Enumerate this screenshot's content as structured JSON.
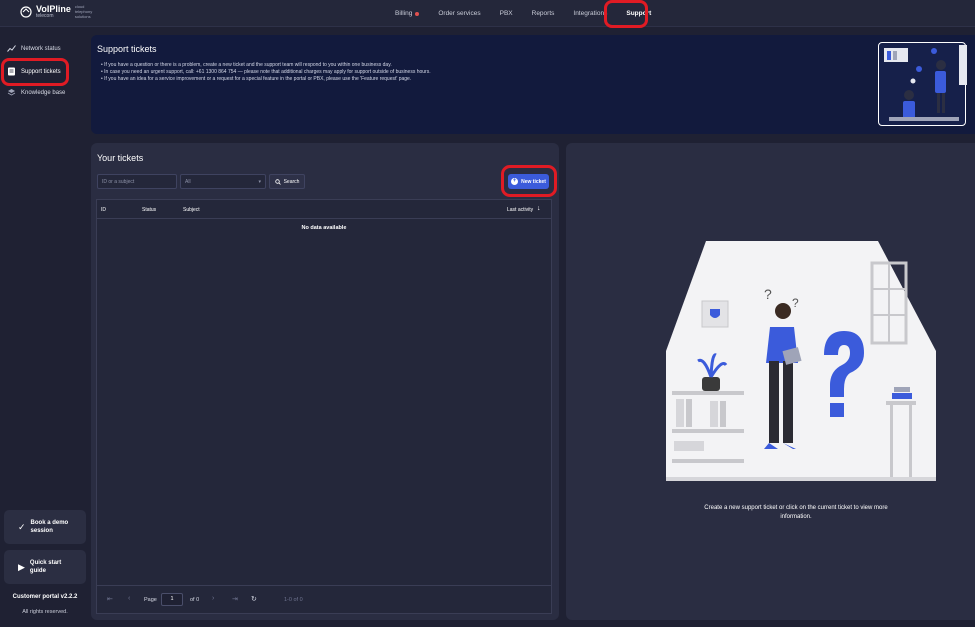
{
  "brand": {
    "name": "VoIPline",
    "sub": "telecom",
    "tagline": "cloud telephony solutions"
  },
  "nav": {
    "items": [
      {
        "label": "Billing",
        "alert": true
      },
      {
        "label": "Order services"
      },
      {
        "label": "PBX"
      },
      {
        "label": "Reports"
      },
      {
        "label": "Integrations"
      },
      {
        "label": "Support",
        "active": true
      }
    ]
  },
  "sidebar": {
    "items": [
      {
        "label": "Network status",
        "icon": "chart-line-icon"
      },
      {
        "label": "Support tickets",
        "icon": "ticket-icon",
        "active": true
      },
      {
        "label": "Knowledge base",
        "icon": "layers-icon"
      }
    ],
    "demo_label": "Book a demo session",
    "guide_label": "Quick start guide",
    "version": "Customer portal v2.2.2",
    "rights": "All rights reserved."
  },
  "banner": {
    "title": "Support tickets",
    "lines": [
      "If you have a question or there is a problem, create a new ticket and the support team will respond to you within one business day.",
      "In case you need an urgent support, call: +61 1300 864 754 — please note that additional charges may apply for support outside of business hours.",
      "If you have an idea for a service improvement or a request for a special feature in the portal or PBX, please use the 'Feature request' page."
    ]
  },
  "tickets": {
    "title": "Your tickets",
    "search_placeholder": "ID or a subject",
    "filter_value": "All",
    "search_label": "Search",
    "new_label": "New ticket",
    "columns": [
      "ID",
      "Status",
      "Subject",
      "Last activity"
    ],
    "empty": "No data available",
    "pager": {
      "page_label": "Page",
      "page_value": "1",
      "of_label": "of 0",
      "range": "1-0 of 0"
    }
  },
  "detail": {
    "caption": "Create a new support ticket or click on the current ticket to view more information."
  },
  "colors": {
    "accent": "#3b5bdb",
    "highlight": "#e01b24",
    "alert": "#e0504f"
  }
}
